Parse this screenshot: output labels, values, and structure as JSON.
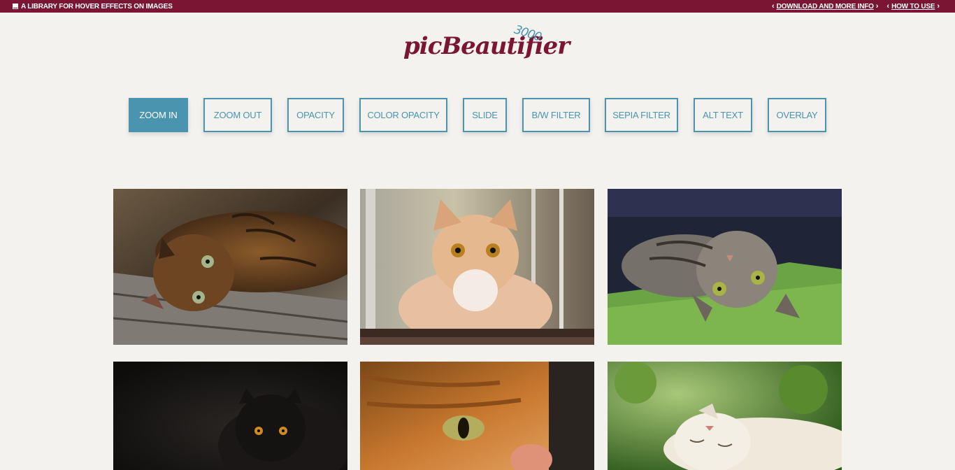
{
  "topbar": {
    "tagline": "A LIBRARY FOR HOVER EFFECTS ON IMAGES",
    "links": [
      "DOWNLOAD AND MORE INFO",
      "HOW TO USE"
    ],
    "bg_color": "#7a1634"
  },
  "logo": {
    "script": "picBeautifier",
    "number": "3000"
  },
  "filters": {
    "active": "ZOOM IN",
    "items": [
      "ZOOM IN",
      "ZOOM OUT",
      "OPACITY",
      "COLOR OPACITY",
      "SLIDE",
      "B/W FILTER",
      "SEPIA FILTER",
      "ALT TEXT",
      "OVERLAY"
    ],
    "accent_color": "#4a94b0"
  },
  "gallery": {
    "images": [
      {
        "subject": "tabby cat lying on wooden bench"
      },
      {
        "subject": "orange and white kitten on ledge"
      },
      {
        "subject": "grey tabby cat lying on green cushion"
      },
      {
        "subject": "black cat with orange eyes"
      },
      {
        "subject": "ginger cat close-up"
      },
      {
        "subject": "white cat lying on grass"
      }
    ]
  }
}
